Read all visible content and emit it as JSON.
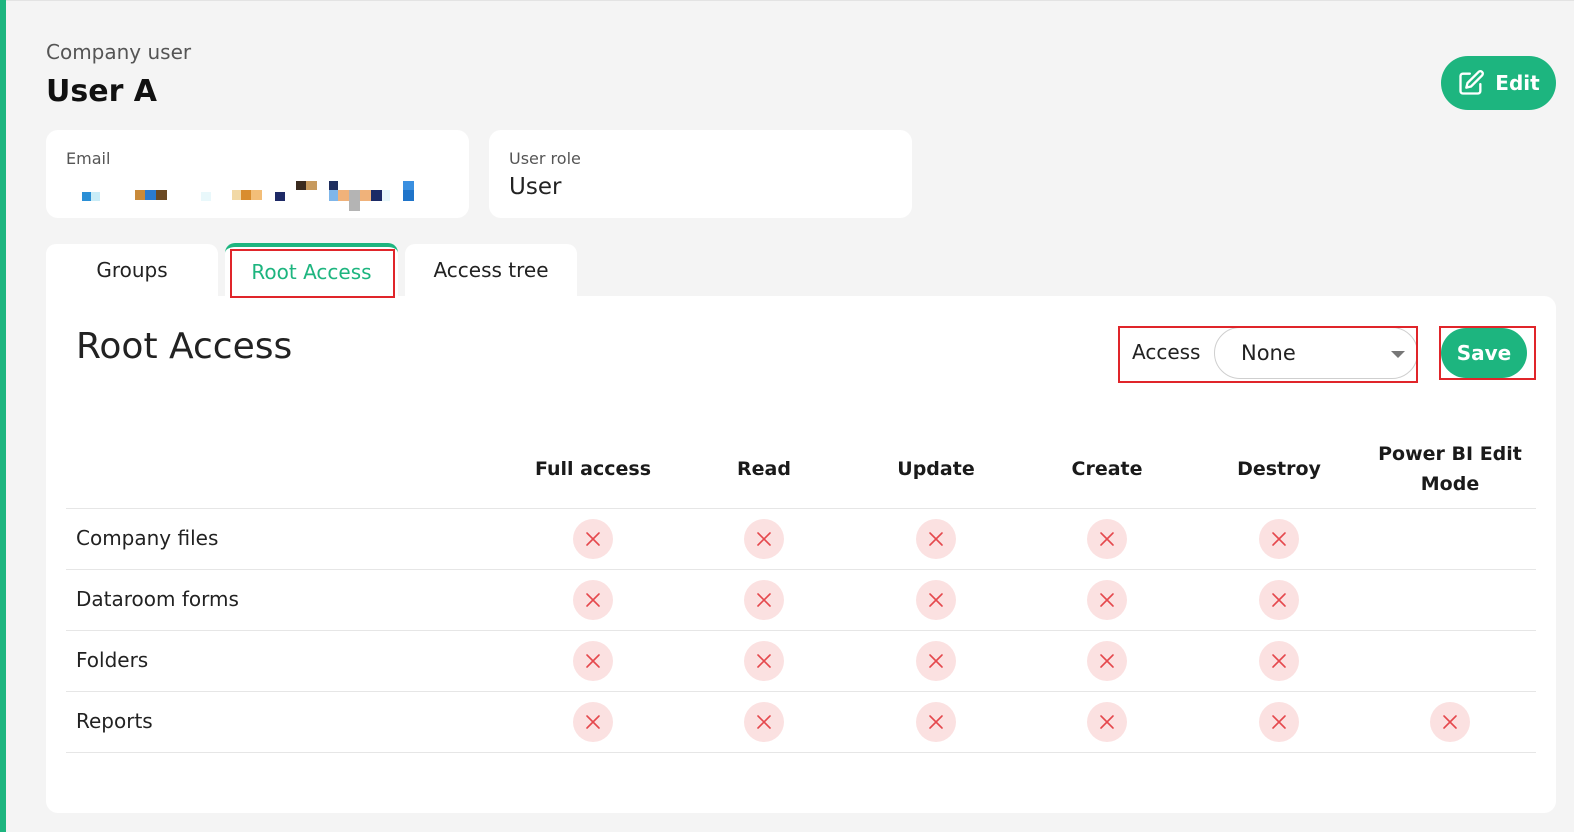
{
  "header": {
    "subtitle": "Company user",
    "title": "User A",
    "edit_label": "Edit"
  },
  "info": {
    "email_label": "Email",
    "role_label": "User role",
    "role_value": "User"
  },
  "tabs": [
    {
      "label": "Groups"
    },
    {
      "label": "Root Access",
      "active": true
    },
    {
      "label": "Access tree"
    }
  ],
  "panel": {
    "title": "Root Access",
    "access_label": "Access",
    "access_value": "None",
    "save_label": "Save"
  },
  "table": {
    "columns": [
      "Full access",
      "Read",
      "Update",
      "Create",
      "Destroy",
      "Power BI Edit Mode"
    ],
    "rows": [
      {
        "label": "Company files",
        "cells": [
          false,
          false,
          false,
          false,
          false,
          null
        ]
      },
      {
        "label": "Dataroom forms",
        "cells": [
          false,
          false,
          false,
          false,
          false,
          null
        ]
      },
      {
        "label": "Folders",
        "cells": [
          false,
          false,
          false,
          false,
          false,
          null
        ]
      },
      {
        "label": "Reports",
        "cells": [
          false,
          false,
          false,
          false,
          false,
          false
        ]
      }
    ]
  },
  "colors": {
    "accent": "#1db57f",
    "denied_bg": "#fbe1e1",
    "denied_icon": "#e5484d",
    "highlight": "#e0252a"
  }
}
